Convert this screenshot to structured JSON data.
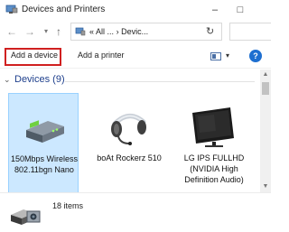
{
  "window": {
    "title": "Devices and Printers",
    "minimize_glyph": "–",
    "maximize_glyph": "□"
  },
  "address": {
    "path_prefix": "«",
    "path": "All ...",
    "separator": "›",
    "current": "Devic...",
    "back_icon": "back-arrow-icon",
    "forward_icon": "forward-arrow-icon",
    "up_icon": "up-arrow-icon"
  },
  "toolbar": {
    "add_device_label": "Add a device",
    "add_printer_label": "Add a printer",
    "help_label": "?"
  },
  "group": {
    "name": "Devices (9)"
  },
  "devices": [
    {
      "label": "150Mbps Wireless 802.11bgn Nano",
      "icon": "network-adapter-icon"
    },
    {
      "label": "boAt Rockerz 510",
      "icon": "headset-icon"
    },
    {
      "label": "LG IPS FULLHD (NVIDIA High Definition Audio)",
      "icon": "monitor-icon"
    }
  ],
  "status": {
    "count_text": "18 items"
  },
  "colors": {
    "highlight_border": "#d02020",
    "group_header": "#1e3f8c",
    "help_blue": "#1e6fd0"
  }
}
